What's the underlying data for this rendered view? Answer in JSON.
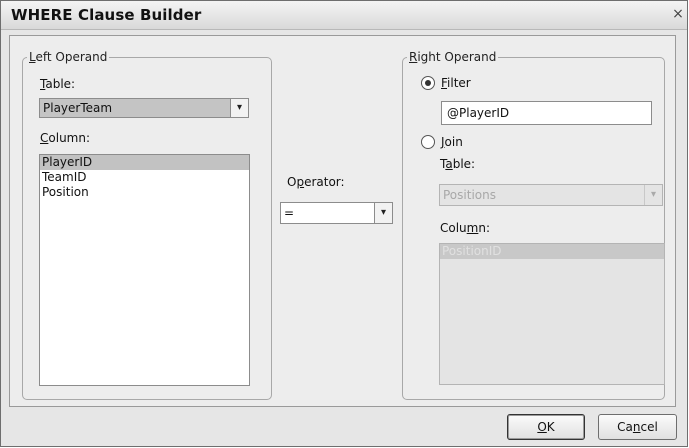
{
  "window": {
    "title": "WHERE Clause Builder",
    "close_glyph": "×"
  },
  "left": {
    "legend_pre": "",
    "legend_key": "L",
    "legend_post": "eft Operand",
    "table_label_key": "T",
    "table_label_post": "able:",
    "table_value": "PlayerTeam",
    "column_label_key": "C",
    "column_label_post": "olumn:",
    "columns": [
      "PlayerID",
      "TeamID",
      "Position"
    ]
  },
  "operator": {
    "label_pre": "O",
    "label_key": "p",
    "label_post": "erator:",
    "value": "="
  },
  "right": {
    "legend_key": "R",
    "legend_post": "ight Operand",
    "filter_label_key": "F",
    "filter_label_post": "ilter",
    "filter_value": "@PlayerID",
    "join_label_key": "J",
    "join_label_post": "oin",
    "table_label_pre": "T",
    "table_label_key": "a",
    "table_label_post": "ble:",
    "table_value": "Positions",
    "column_label_pre": "Colu",
    "column_label_key": "m",
    "column_label_post": "n:",
    "columns": [
      "PositionID"
    ]
  },
  "buttons": {
    "ok_key": "O",
    "ok_post": "K",
    "cancel_pre": "Ca",
    "cancel_key": "n",
    "cancel_post": "cel"
  },
  "icons": {
    "dropdown": "chevron-down-icon",
    "close": "close-icon"
  }
}
